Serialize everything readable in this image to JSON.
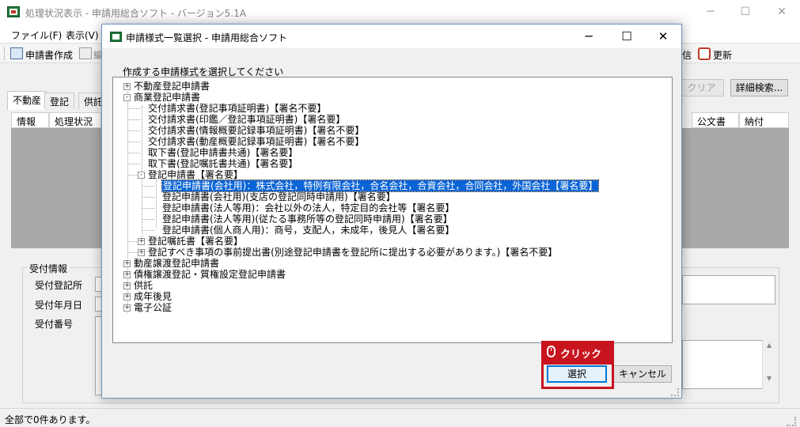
{
  "main_window": {
    "title": "処理状況表示 - 申請用総合ソフト - バージョン5.1A",
    "menu": [
      "ファイル(F)",
      "表示(V)"
    ],
    "toolbar": {
      "create_label": "申請書作成",
      "edit_label": "編",
      "partial_right": "信",
      "refresh_label": "更新"
    },
    "tabs": [
      "不動産",
      "登記",
      "供託"
    ],
    "columns_left": [
      "情報",
      "処理状況"
    ],
    "columns_right": [
      "公文書",
      "納付"
    ],
    "clear_label": "クリア",
    "detail_search_label": "詳細検索...",
    "reception_group": {
      "title": "受付情報",
      "fields": [
        "受付登記所",
        "受付年月日",
        "受付番号"
      ]
    },
    "status_text": "全部で0件あります。"
  },
  "dialog": {
    "title": "申請様式一覧選択 - 申請用総合ソフト",
    "instruction": "作成する申請様式を選択してください",
    "tree": [
      {
        "label": "不動産登記申請書",
        "level": 0,
        "expander": "+"
      },
      {
        "label": "商業登記申請書",
        "level": 0,
        "expander": "-"
      },
      {
        "label": "交付請求書(登記事項証明書)【署名不要】",
        "level": 1,
        "expander": ""
      },
      {
        "label": "交付請求書(印鑑／登記事項証明書)【署名要】",
        "level": 1,
        "expander": ""
      },
      {
        "label": "交付請求書(情報概要記録事項証明書)【署名不要】",
        "level": 1,
        "expander": ""
      },
      {
        "label": "交付請求書(動産概要記録事項証明書)【署名不要】",
        "level": 1,
        "expander": ""
      },
      {
        "label": "取下書(登記申請書共通)【署名要】",
        "level": 1,
        "expander": ""
      },
      {
        "label": "取下書(登記嘱託書共通)【署名要】",
        "level": 1,
        "expander": ""
      },
      {
        "label": "登記申請書【署名要】",
        "level": 1,
        "expander": "-"
      },
      {
        "label": "登記申請書(会社用)：株式会社，特例有限会社，合名会社，合資会社，合同会社，外国会社【署名要】",
        "level": 2,
        "expander": "",
        "selected": true
      },
      {
        "label": "登記申請書(会社用)(支店の登記同時申請用)【署名要】",
        "level": 2,
        "expander": ""
      },
      {
        "label": "登記申請書(法人等用)：会社以外の法人，特定目的会社等【署名要】",
        "level": 2,
        "expander": ""
      },
      {
        "label": "登記申請書(法人等用)(従たる事務所等の登記同時申請用)【署名要】",
        "level": 2,
        "expander": ""
      },
      {
        "label": "登記申請書(個人商人用)：商号，支配人，未成年，後見人【署名要】",
        "level": 2,
        "expander": ""
      },
      {
        "label": "登記嘱託書【署名要】",
        "level": 1,
        "expander": "+"
      },
      {
        "label": "登記すべき事項の事前提出書(別途登記申請書を登記所に提出する必要があります。)【署名不要】",
        "level": 1,
        "expander": "+"
      },
      {
        "label": "動産譲渡登記申請書",
        "level": 0,
        "expander": "+"
      },
      {
        "label": "債権譲渡登記・質権設定登記申請書",
        "level": 0,
        "expander": "+"
      },
      {
        "label": "供託",
        "level": 0,
        "expander": "+"
      },
      {
        "label": "成年後見",
        "level": 0,
        "expander": "+"
      },
      {
        "label": "電子公証",
        "level": 0,
        "expander": "+"
      }
    ],
    "select_label": "選択",
    "cancel_label": "キャンセル"
  },
  "callout": {
    "text": "クリック",
    "icon": "mouse-icon",
    "color": "#c8141e"
  }
}
